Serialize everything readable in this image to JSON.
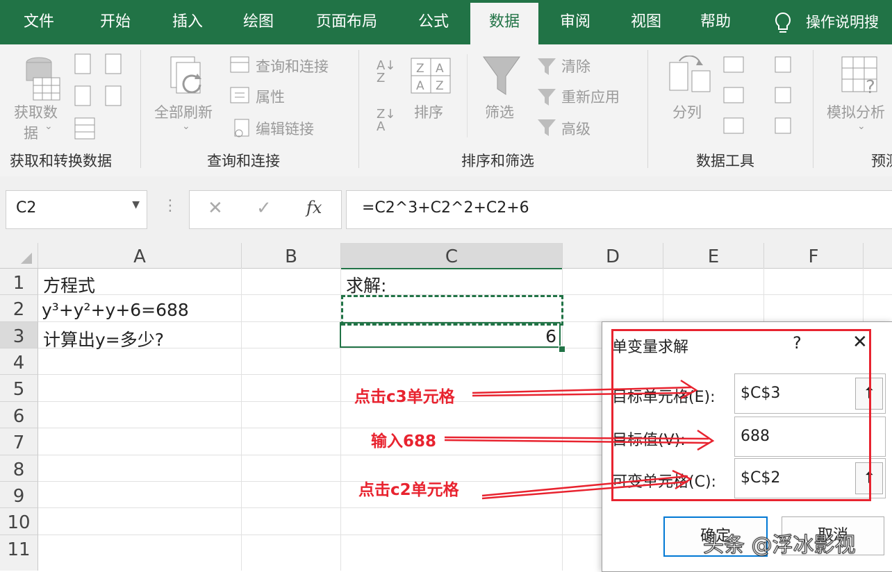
{
  "tabs": [
    "文件",
    "开始",
    "插入",
    "绘图",
    "页面布局",
    "公式",
    "数据",
    "审阅",
    "视图",
    "帮助",
    "操作说明搜"
  ],
  "active_tab": "数据",
  "ribbon": {
    "get_data_line1": "获取数",
    "get_data_line2": "据",
    "group_get": "获取和转换数据",
    "refresh_all": "全部刷新",
    "queries_connections": "查询和连接",
    "properties": "属性",
    "edit_links": "编辑链接",
    "group_queries": "查询和连接",
    "sort": "排序",
    "filter": "筛选",
    "clear": "清除",
    "reapply": "重新应用",
    "advanced": "高级",
    "group_sort": "排序和筛选",
    "text_to_columns": "分列",
    "group_data_tools": "数据工具",
    "what_if": "模拟分析",
    "group_forecast": "预测"
  },
  "formula_bar": {
    "name_box": "C2",
    "formula": "=C2^3+C2^2+C2+6",
    "fx": "fx"
  },
  "sheet": {
    "columns": [
      "A",
      "B",
      "C",
      "D",
      "E",
      "F"
    ],
    "rows": [
      "1",
      "2",
      "3",
      "4",
      "5",
      "6",
      "7",
      "8",
      "9",
      "10",
      "11"
    ],
    "cells": {
      "A1": "方程式",
      "A2": "y³+y²+y+6=688",
      "A3": "计算出y=多少?",
      "C1": "求解:",
      "C3": "6"
    }
  },
  "dialog": {
    "title": "单变量求解",
    "help": "?",
    "close": "✕",
    "set_cell_label": "目标单元格(E):",
    "set_cell_value": "$C$3",
    "to_value_label": "目标值(V):",
    "to_value_value": "688",
    "changing_cell_label": "可变单元格(C):",
    "changing_cell_value": "$C$2",
    "ok": "确定",
    "cancel": "取消"
  },
  "annotations": {
    "a1": "点击c3单元格",
    "a2": "输入688",
    "a3": "点击c2单元格"
  },
  "watermark": "头条 @浮冰影视",
  "colors": {
    "excel_green": "#217346",
    "annotation_red": "#e8232f"
  }
}
